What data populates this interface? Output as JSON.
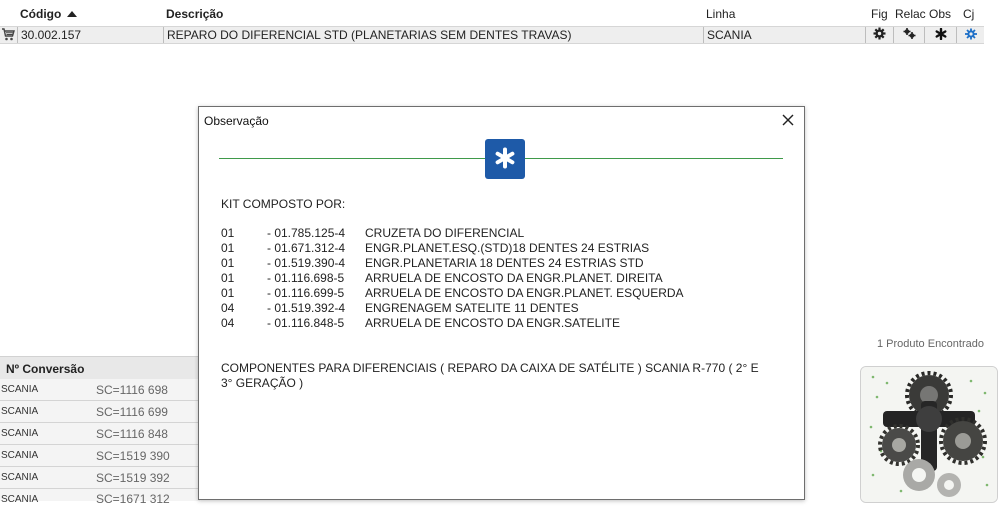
{
  "table": {
    "headers": {
      "codigo": "Código",
      "descricao": "Descrição",
      "linha": "Linha",
      "fig": "Fig",
      "relac": "Relac",
      "obs": "Obs",
      "cj": "Cj"
    },
    "row": {
      "codigo": "30.002.157",
      "descricao": "REPARO DO DIFERENCIAL STD (PLANETARIAS SEM  DENTES TRAVAS)",
      "linha": "SCANIA"
    },
    "found_text": "1 Produto Encontrado"
  },
  "conversion": {
    "header": "Nº Conversão",
    "rows": [
      {
        "marca": "SCANIA",
        "valor": "SC=1116 698"
      },
      {
        "marca": "SCANIA",
        "valor": "SC=1116 699"
      },
      {
        "marca": "SCANIA",
        "valor": "SC=1116 848"
      },
      {
        "marca": "SCANIA",
        "valor": "SC=1519 390"
      },
      {
        "marca": "SCANIA",
        "valor": "SC=1519 392"
      },
      {
        "marca": "SCANIA",
        "valor": "SC=1671 312"
      }
    ]
  },
  "modal": {
    "title": "Observação",
    "intro": "KIT COMPOSTO POR:",
    "items": [
      {
        "qty": "01",
        "code": "- 01.785.125-4",
        "desc": "CRUZETA DO DIFERENCIAL"
      },
      {
        "qty": "01",
        "code": "- 01.671.312-4",
        "desc": "ENGR.PLANET.ESQ.(STD)18 DENTES 24 ESTRIAS"
      },
      {
        "qty": "01",
        "code": "- 01.519.390-4",
        "desc": "ENGR.PLANETARIA 18 DENTES 24 ESTRIAS STD"
      },
      {
        "qty": "01",
        "code": "- 01.116.698-5",
        "desc": "ARRUELA DE ENCOSTO DA ENGR.PLANET. DIREITA"
      },
      {
        "qty": "01",
        "code": "- 01.116.699-5",
        "desc": "ARRUELA DE ENCOSTO DA ENGR.PLANET. ESQUERDA"
      },
      {
        "qty": "04",
        "code": "- 01.519.392-4",
        "desc": "ENGRENAGEM SATELITE 11 DENTES"
      },
      {
        "qty": "04",
        "code": "- 01.116.848-5",
        "desc": "ARRUELA DE ENCOSTO DA ENGR.SATELITE"
      }
    ],
    "footer_line1": "COMPONENTES PARA DIFERENCIAIS ( REPARO DA CAIXA DE SATÉLITE ) SCANIA R-770 ( 2° E",
    "footer_line2": "3° GERAÇÃO )"
  },
  "colors": {
    "accent_blue": "#1e5aa8",
    "divider_green": "#3f9a4a"
  },
  "icons": {
    "cart": "cart-icon",
    "fig": "gear-icon",
    "relac": "related-gear-icon",
    "obs": "asterisk-icon",
    "cj": "set-gear-icon",
    "close": "close-icon"
  }
}
